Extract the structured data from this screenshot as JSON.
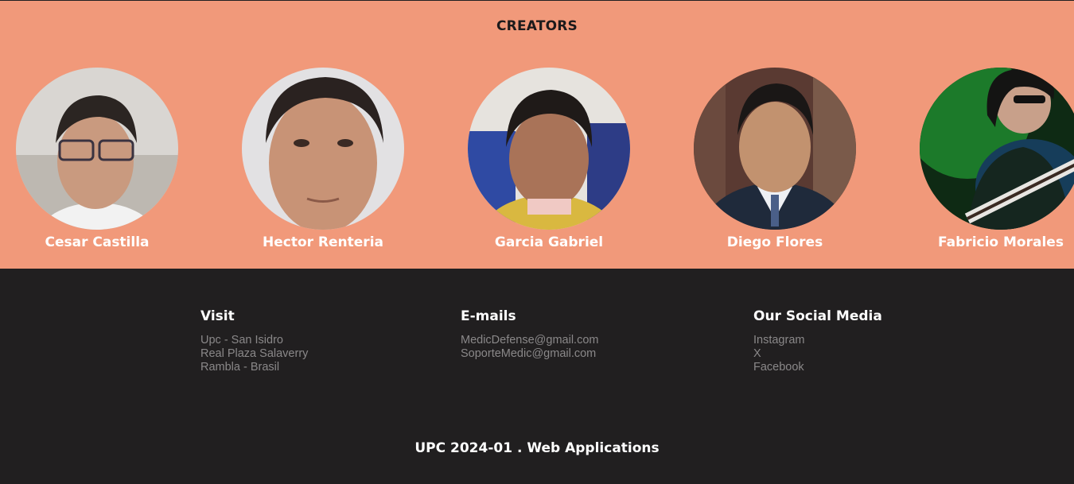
{
  "creators": {
    "title": "CREATORS",
    "people": [
      {
        "name": "Cesar Castilla"
      },
      {
        "name": "Hector Renteria"
      },
      {
        "name": "Garcia Gabriel"
      },
      {
        "name": "Diego Flores"
      },
      {
        "name": "Fabricio Morales"
      }
    ]
  },
  "footer": {
    "visit": {
      "title": "Visit",
      "items": [
        "Upc - San Isidro",
        "Real Plaza Salaverry",
        "Rambla - Brasil"
      ]
    },
    "emails": {
      "title": "E-mails",
      "items": [
        "MedicDefense@gmail.com",
        "SoporteMedic@gmail.com"
      ]
    },
    "social": {
      "title": "Our Social Media",
      "items": [
        "Instagram",
        "X",
        "Facebook"
      ]
    },
    "copyright": "UPC 2024-01 . Web Applications"
  },
  "colors": {
    "creators_bg": "#f1997a",
    "footer_bg": "#211f20",
    "muted_text": "#8a8889"
  }
}
